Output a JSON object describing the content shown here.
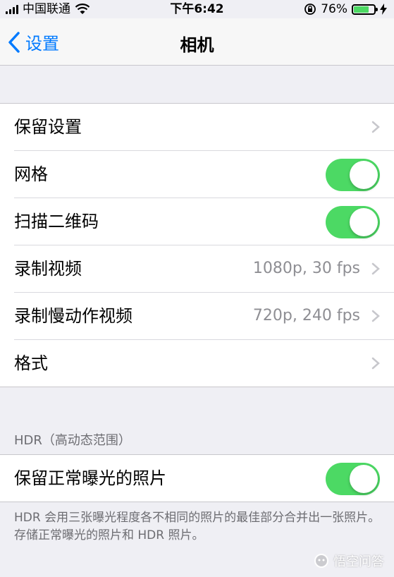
{
  "status_bar": {
    "carrier": "中国联通",
    "time": "下午6:42",
    "battery": "76%",
    "battery_level": 0.76
  },
  "nav": {
    "back_label": "设置",
    "title": "相机"
  },
  "settings": [
    {
      "label": "保留设置",
      "type": "link",
      "value": ""
    },
    {
      "label": "网格",
      "type": "toggle",
      "on": true
    },
    {
      "label": "扫描二维码",
      "type": "toggle",
      "on": true
    },
    {
      "label": "录制视频",
      "type": "link",
      "value": "1080p, 30 fps"
    },
    {
      "label": "录制慢动作视频",
      "type": "link",
      "value": "720p, 240 fps"
    },
    {
      "label": "格式",
      "type": "link",
      "value": ""
    }
  ],
  "hdr": {
    "header": "HDR（高动态范围）",
    "row_label": "保留正常曝光的照片",
    "row_on": true,
    "footer": "HDR 会用三张曝光程度各不相同的照片的最佳部分合并出一张照片。存储正常曝光的照片和 HDR 照片。"
  },
  "watermark": "悟空问答",
  "colors": {
    "accent": "#007aff",
    "toggle_on": "#4cd964",
    "background": "#efeff4"
  }
}
